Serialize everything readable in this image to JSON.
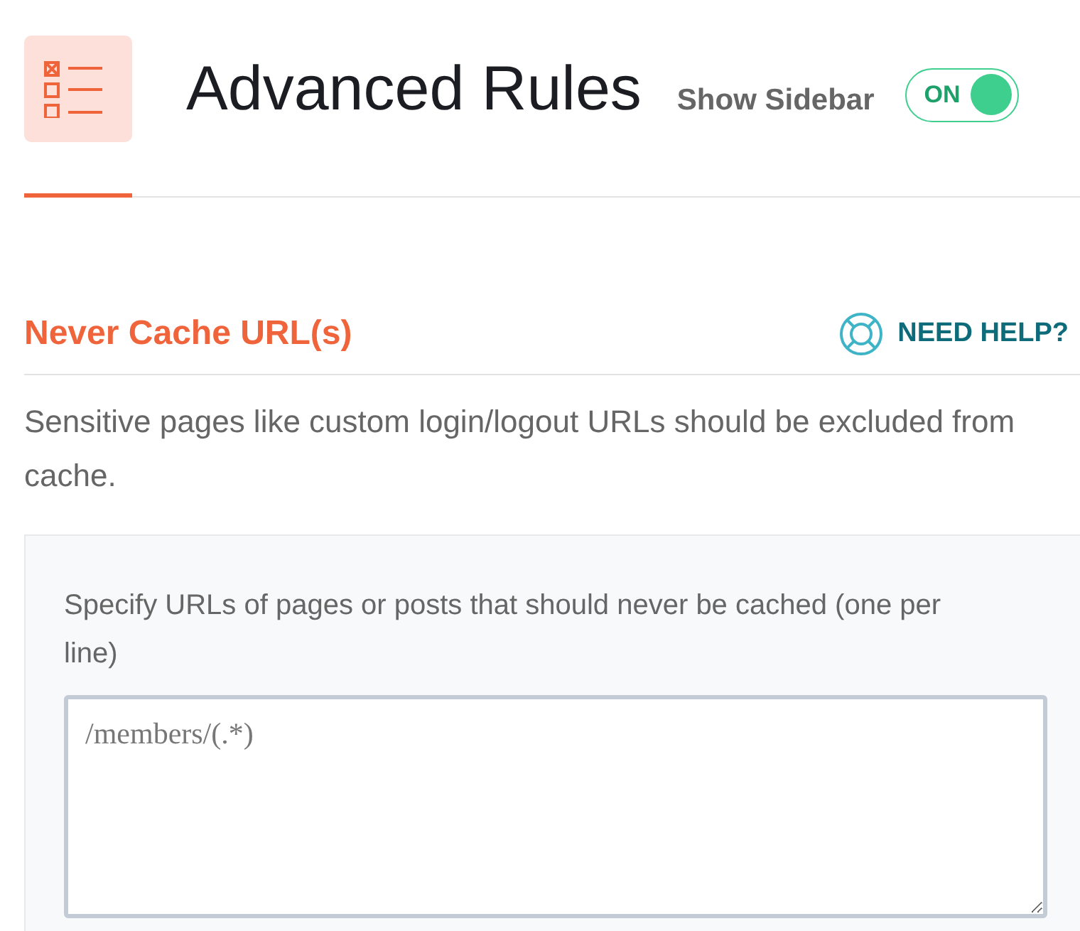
{
  "header": {
    "title": "Advanced Rules",
    "sidebar_toggle": {
      "label": "Show Sidebar",
      "state_text": "ON",
      "on": true
    }
  },
  "tabs": [
    {
      "selected": true
    }
  ],
  "section": {
    "title": "Never Cache URL(s)",
    "help": "NEED HELP?",
    "description": "Sensitive pages like custom login/logout URLs should be excluded from cache.",
    "field": {
      "label": "Specify URLs of pages or posts that should never be cached (one per line)",
      "placeholder": "/members/(.*)"
    }
  }
}
